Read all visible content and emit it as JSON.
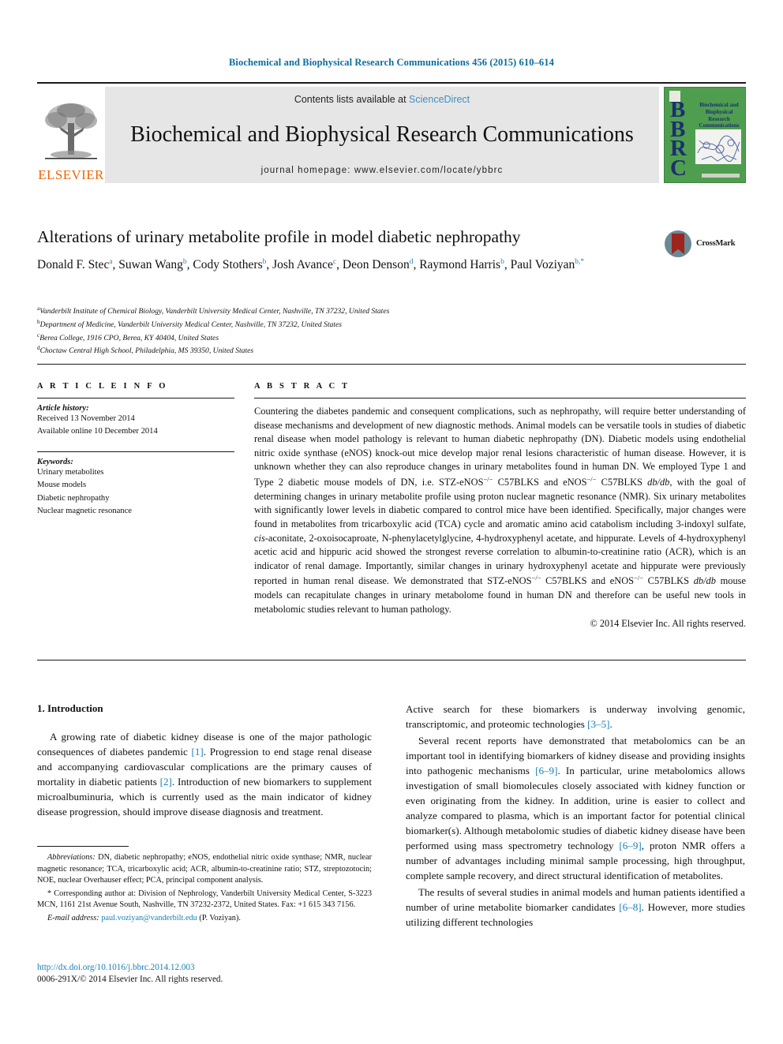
{
  "running_head": "Biochemical and Biophysical Research Communications 456 (2015) 610–614",
  "masthead": {
    "contents_prefix": "Contents lists available at ",
    "sciencedirect": "ScienceDirect",
    "journal_title": "Biochemical and Biophysical Research Communications",
    "homepage": "journal homepage: www.elsevier.com/locate/ybbrc",
    "publisher_name": "ELSEVIER",
    "cover_letters": "BBRC",
    "cover_title": "Biochemical and Biophysical Research Communications",
    "colors": {
      "link_blue": "#3e8fc0",
      "elsevier_orange": "#ec6608",
      "cover_green": "#4f9e4f",
      "cover_navy": "#1c2f6e",
      "band_gray": "#e6e6e6"
    }
  },
  "article": {
    "title": "Alterations of urinary metabolite profile in model diabetic nephropathy",
    "crossmark_label": "CrossMark",
    "authors_html": "Donald F. Stec<sup>a</sup>, Suwan Wang<sup>b</sup>, Cody Stothers<sup>b</sup>, Josh Avance<sup>c</sup>, Deon Denson<sup>d</sup>, Raymond Harris<sup>b</sup>, Paul Voziyan<sup>b,</sup><sup>*</sup>",
    "affiliations": [
      {
        "marker": "a",
        "text": "Vanderbilt Institute of Chemical Biology, Vanderbilt University Medical Center, Nashville, TN 37232, United States"
      },
      {
        "marker": "b",
        "text": "Department of Medicine, Vanderbilt University Medical Center, Nashville, TN 37232, United States"
      },
      {
        "marker": "c",
        "text": "Berea College, 1916 CPO, Berea, KY 40404, United States"
      },
      {
        "marker": "d",
        "text": "Choctaw Central High School, Philadelphia, MS 39350, United States"
      }
    ]
  },
  "article_info": {
    "heading": "A R T I C L E   I N F O",
    "history_label": "Article history:",
    "history": [
      "Received 13 November 2014",
      "Available online 10 December 2014"
    ],
    "keywords_label": "Keywords:",
    "keywords": [
      "Urinary metabolites",
      "Mouse models",
      "Diabetic nephropathy",
      "Nuclear magnetic resonance"
    ]
  },
  "abstract": {
    "heading": "A B S T R A C T",
    "body_html": "Countering the diabetes pandemic and consequent complications, such as nephropathy, will require better understanding of disease mechanisms and development of new diagnostic methods. Animal models can be versatile tools in studies of diabetic renal disease when model pathology is relevant to human diabetic nephropathy (DN). Diabetic models using endothelial nitric oxide synthase (eNOS) knock-out mice develop major renal lesions characteristic of human disease. However, it is unknown whether they can also reproduce changes in urinary metabolites found in human DN. We employed Type 1 and Type 2 diabetic mouse models of DN, i.e. STZ-eNOS<sup>&minus;/&minus;</sup> C57BLKS and eNOS<sup>&minus;/&minus;</sup> C57BLKS <i>db/db</i>, with the goal of determining changes in urinary metabolite profile using proton nuclear magnetic resonance (NMR). Six urinary metabolites with significantly lower levels in diabetic compared to control mice have been identified. Specifically, major changes were found in metabolites from tricarboxylic acid (TCA) cycle and aromatic amino acid catabolism including 3-indoxyl sulfate, <i>cis</i>-aconitate, 2-oxoisocaproate, N-phenylacetylglycine, 4-hydroxyphenyl acetate, and hippurate. Levels of 4-hydroxyphenyl acetic acid and hippuric acid showed the strongest reverse correlation to albumin-to-creatinine ratio (ACR), which is an indicator of renal damage. Importantly, similar changes in urinary hydroxyphenyl acetate and hippurate were previously reported in human renal disease. We demonstrated that STZ-eNOS<sup>&minus;/&minus;</sup> C57BLKS and eNOS<sup>&minus;/&minus;</sup> C57BLKS <i>db/db</i> mouse models can recapitulate changes in urinary metabolome found in human DN and therefore can be useful new tools in metabolomic studies relevant to human pathology.",
    "copyright": "© 2014 Elsevier Inc. All rights reserved."
  },
  "introduction": {
    "heading": "1. Introduction",
    "left_paragraphs_html": [
      "A growing rate of diabetic kidney disease is one of the major pathologic consequences of diabetes pandemic <span class=\"ref\">[1]</span>. Progression to end stage renal disease and accompanying cardiovascular complications are the primary causes of mortality in diabetic patients <span class=\"ref\">[2]</span>. Introduction of new biomarkers to supplement microalbuminuria, which is currently used as the main indicator of kidney disease progression, should improve disease diagnosis and treatment."
    ],
    "right_paragraphs_html": [
      "Active search for these biomarkers is underway involving genomic, transcriptomic, and proteomic technologies <span class=\"ref\">[3&ndash;5]</span>.",
      "Several recent reports have demonstrated that metabolomics can be an important tool in identifying biomarkers of kidney disease and providing insights into pathogenic mechanisms <span class=\"ref\">[6&ndash;9]</span>. In particular, urine metabolomics allows investigation of small biomolecules closely associated with kidney function or even originating from the kidney. In addition, urine is easier to collect and analyze compared to plasma, which is an important factor for potential clinical biomarker(s). Although metabolomic studies of diabetic kidney disease have been performed using mass spectrometry technology <span class=\"ref\">[6&ndash;9]</span>, proton NMR offers a number of advantages including minimal sample processing, high throughput, complete sample recovery, and direct structural identification of metabolites.",
      "The results of several studies in animal models and human patients identified a number of urine metabolite biomarker candidates <span class=\"ref\">[6&ndash;8]</span>. However, more studies utilizing different technologies"
    ]
  },
  "footnotes": {
    "abbreviations_html": "<i>Abbreviations:</i> DN, diabetic nephropathy; eNOS, endothelial nitric oxide synthase; NMR, nuclear magnetic resonance; TCA, tricarboxylic acid; ACR, albumin-to-creatinine ratio; STZ, streptozotocin; NOE, nuclear Overhauser effect; PCA, principal component analysis.",
    "corresponding_html": "* Corresponding author at: Division of Nephrology, Vanderbilt University Medical Center, S-3223 MCN, 1161 21st Avenue South, Nashville, TN 37232-2372, United States. Fax: +1 615 343 7156.",
    "email_label": "E-mail address:",
    "email": "paul.voziyan@vanderbilt.edu",
    "email_suffix": "(P. Voziyan)."
  },
  "footer": {
    "doi": "http://dx.doi.org/10.1016/j.bbrc.2014.12.003",
    "issn": "0006-291X/© 2014 Elsevier Inc. All rights reserved."
  }
}
